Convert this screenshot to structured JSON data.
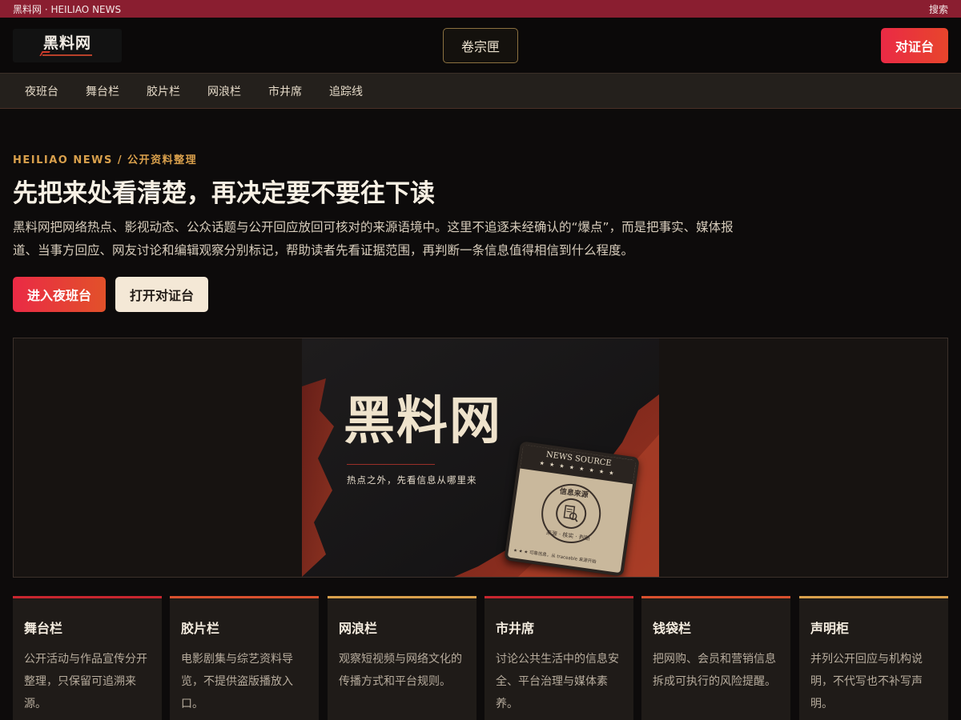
{
  "topbar": {
    "site_label": "黑料网 · HEILIAO NEWS",
    "search_label": "搜索"
  },
  "header": {
    "logo_text": "黑料网",
    "archive_label": "卷宗匣",
    "verify_label": "对证台"
  },
  "nav": {
    "items": [
      "夜班台",
      "舞台栏",
      "胶片栏",
      "网浪栏",
      "市井席",
      "追踪线"
    ]
  },
  "hero": {
    "eyebrow": "HEILIAO NEWS / 公开资料整理",
    "title": "先把来处看清楚，再决定要不要往下读",
    "description": "黑料网把网络热点、影视动态、公众话题与公开回应放回可核对的来源语境中。这里不追逐未经确认的“爆点”，而是把事实、媒体报道、当事方回应、网友讨论和编辑观察分别标记，帮助读者先看证据范围，再判断一条信息值得相信到什么程度。",
    "primary_button": "进入夜班台",
    "secondary_button": "打开对证台"
  },
  "banner": {
    "title": "黑料网",
    "subtitle": "热点之外，先看信息从哪里来",
    "stamp_header": "NEWS SOURCE",
    "stamp_stars": "★ ★ ★ ★ ★ ★ ★ ★",
    "stamp_ring_top": "信息来源",
    "stamp_ring_bottom": "来源 · 核实 · 判断",
    "stamp_footer": "★ ★ ★ 可靠信息，从 traceable 来源开始"
  },
  "cards": [
    {
      "title": "舞台栏",
      "description": "公开活动与作品宣传分开整理，只保留可追溯来源。",
      "accent": "#c8262f"
    },
    {
      "title": "胶片栏",
      "description": "电影剧集与综艺资料导览，不提供盗版播放入口。",
      "accent": "#d8502e"
    },
    {
      "title": "网浪栏",
      "description": "观察短视频与网络文化的传播方式和平台规则。",
      "accent": "#d9a04c"
    },
    {
      "title": "市井席",
      "description": "讨论公共生活中的信息安全、平台治理与媒体素养。",
      "accent": "#c8262f"
    },
    {
      "title": "钱袋栏",
      "description": "把网购、会员和营销信息拆成可执行的风险提醒。",
      "accent": "#d8502e"
    },
    {
      "title": "声明柜",
      "description": "并列公开回应与机构说明，不代写也不补写声明。",
      "accent": "#d9a04c"
    }
  ]
}
